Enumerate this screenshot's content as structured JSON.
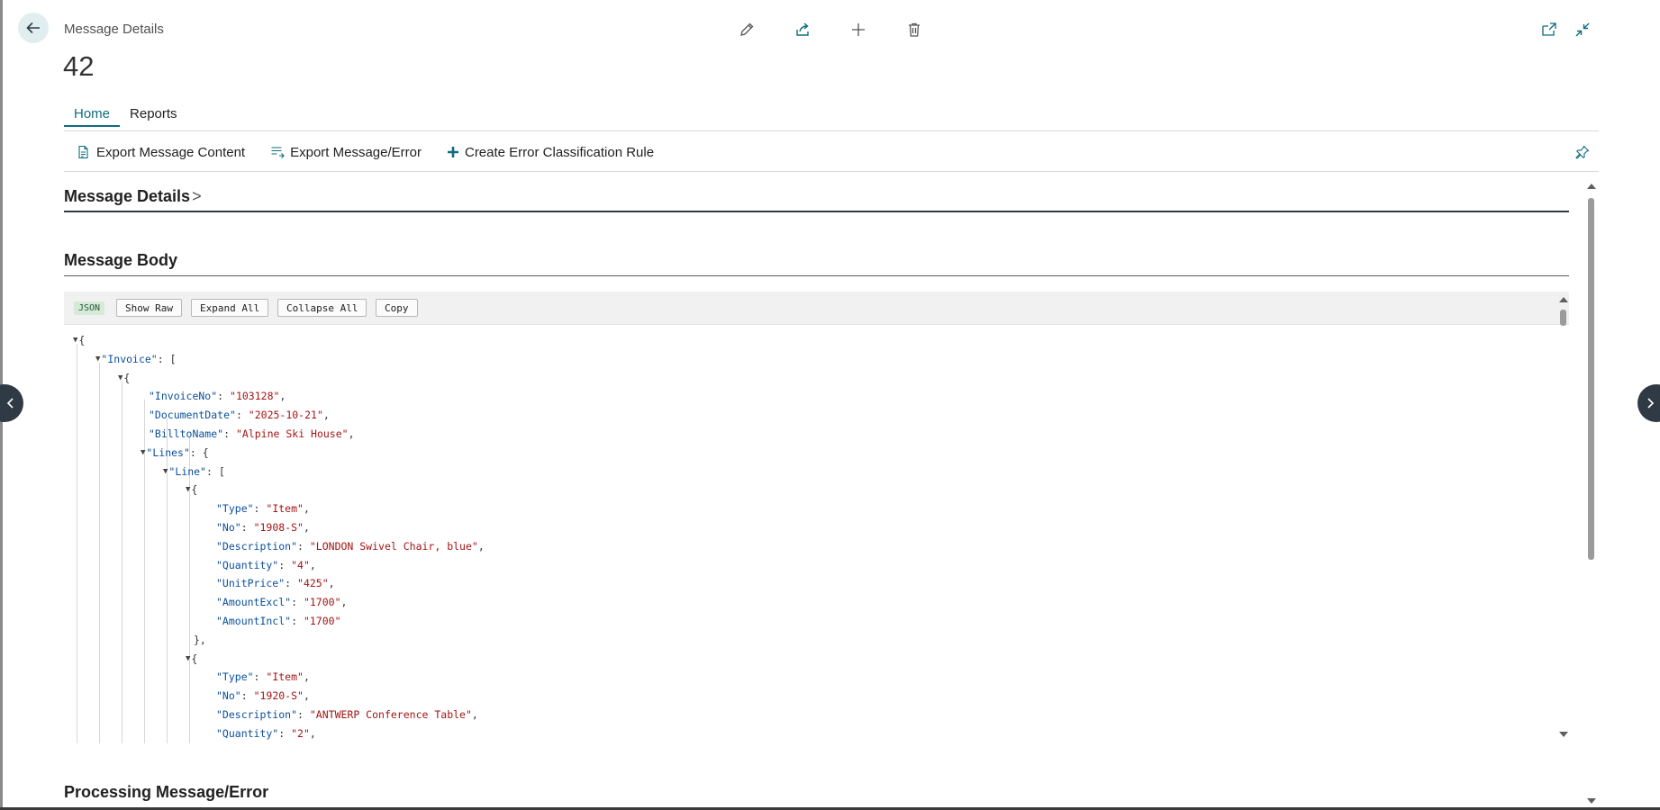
{
  "header": {
    "breadcrumb": "Message Details",
    "record_no": "42"
  },
  "icons": {
    "back": "back-arrow-icon",
    "edit": "pencil-icon",
    "share": "share-icon",
    "new": "plus-icon",
    "delete": "trash-icon",
    "open_new": "open-in-new-window-icon",
    "collapse": "collapse-icon",
    "pin": "pin-icon"
  },
  "tabs": [
    {
      "label": "Home",
      "active": true
    },
    {
      "label": "Reports",
      "active": false
    }
  ],
  "actions": [
    {
      "label": "Export Message Content",
      "icon": "export-document-icon"
    },
    {
      "label": "Export Message/Error",
      "icon": "export-list-icon"
    },
    {
      "label": "Create Error Classification Rule",
      "icon": "plus-icon"
    }
  ],
  "sections": {
    "details": "Message Details",
    "details_chevron": ">",
    "body": "Message Body",
    "processing": "Processing Message/Error"
  },
  "viewer": {
    "badge": "JSON",
    "buttons": [
      "Show Raw",
      "Expand All",
      "Collapse All",
      "Copy"
    ]
  },
  "json_lines": [
    {
      "depth": 0,
      "toggle": true,
      "pre": "{",
      "key": "",
      "val": "",
      "post": ""
    },
    {
      "depth": 1,
      "toggle": true,
      "pre": "",
      "key": "\"Invoice\"",
      "val": "",
      "post": ": ["
    },
    {
      "depth": 2,
      "toggle": true,
      "pre": "{",
      "key": "",
      "val": "",
      "post": ""
    },
    {
      "depth": 3,
      "toggle": false,
      "pre": "",
      "key": "\"InvoiceNo\"",
      "val": "\"103128\"",
      "post": ","
    },
    {
      "depth": 3,
      "toggle": false,
      "pre": "",
      "key": "\"DocumentDate\"",
      "val": "\"2025-10-21\"",
      "post": ","
    },
    {
      "depth": 3,
      "toggle": false,
      "pre": "",
      "key": "\"BilltoName\"",
      "val": "\"Alpine Ski House\"",
      "post": ","
    },
    {
      "depth": 3,
      "toggle": true,
      "pre": "",
      "key": "\"Lines\"",
      "val": "",
      "post": ": {"
    },
    {
      "depth": 4,
      "toggle": true,
      "pre": "",
      "key": "\"Line\"",
      "val": "",
      "post": ": ["
    },
    {
      "depth": 5,
      "toggle": true,
      "pre": "{",
      "key": "",
      "val": "",
      "post": ""
    },
    {
      "depth": 6,
      "toggle": false,
      "pre": "",
      "key": "\"Type\"",
      "val": "\"Item\"",
      "post": ","
    },
    {
      "depth": 6,
      "toggle": false,
      "pre": "",
      "key": "\"No\"",
      "val": "\"1908-S\"",
      "post": ","
    },
    {
      "depth": 6,
      "toggle": false,
      "pre": "",
      "key": "\"Description\"",
      "val": "\"LONDON Swivel Chair, blue\"",
      "post": ","
    },
    {
      "depth": 6,
      "toggle": false,
      "pre": "",
      "key": "\"Quantity\"",
      "val": "\"4\"",
      "post": ","
    },
    {
      "depth": 6,
      "toggle": false,
      "pre": "",
      "key": "\"UnitPrice\"",
      "val": "\"425\"",
      "post": ","
    },
    {
      "depth": 6,
      "toggle": false,
      "pre": "",
      "key": "\"AmountExcl\"",
      "val": "\"1700\"",
      "post": ","
    },
    {
      "depth": 6,
      "toggle": false,
      "pre": "",
      "key": "\"AmountIncl\"",
      "val": "\"1700\"",
      "post": ""
    },
    {
      "depth": 5,
      "toggle": false,
      "pre": "},",
      "key": "",
      "val": "",
      "post": ""
    },
    {
      "depth": 5,
      "toggle": true,
      "pre": "{",
      "key": "",
      "val": "",
      "post": ""
    },
    {
      "depth": 6,
      "toggle": false,
      "pre": "",
      "key": "\"Type\"",
      "val": "\"Item\"",
      "post": ","
    },
    {
      "depth": 6,
      "toggle": false,
      "pre": "",
      "key": "\"No\"",
      "val": "\"1920-S\"",
      "post": ","
    },
    {
      "depth": 6,
      "toggle": false,
      "pre": "",
      "key": "\"Description\"",
      "val": "\"ANTWERP Conference Table\"",
      "post": ","
    },
    {
      "depth": 6,
      "toggle": false,
      "pre": "",
      "key": "\"Quantity\"",
      "val": "\"2\"",
      "post": ","
    }
  ],
  "colors": {
    "accent": "#0f6c7f",
    "json_key": "#0b4f9a",
    "json_string": "#a31515",
    "badge_bg": "#d6ead9"
  }
}
